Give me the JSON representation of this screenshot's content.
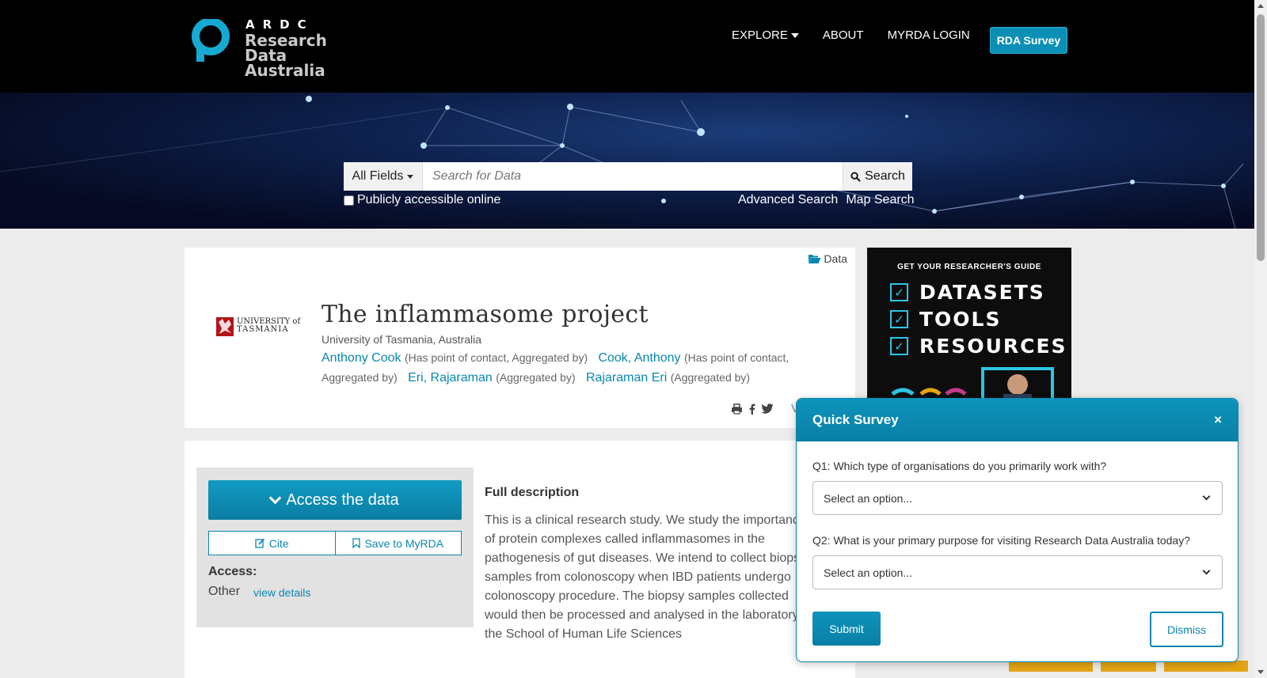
{
  "header": {
    "logo_ardc": "ARDC",
    "logo_line1": "Research Data",
    "logo_line2": "Australia",
    "nav": [
      {
        "label": "EXPLORE"
      },
      {
        "label": "ABOUT"
      },
      {
        "label": "MYRDA LOGIN"
      }
    ],
    "survey_button": "RDA Survey"
  },
  "search": {
    "field_select": "All Fields",
    "placeholder": "Search for Data",
    "button": "Search",
    "public_checkbox_label": "Publicly accessible online",
    "public_checked": false,
    "advanced_link": "Advanced Search",
    "map_link": "Map Search"
  },
  "record": {
    "type_badge": "Data",
    "logo_text_line1": "UNIVERSITY of",
    "logo_text_line2": "TASMANIA",
    "title": "The inflammasome project",
    "organisation": "University of Tasmania, Australia",
    "contacts": [
      {
        "name": "Anthony Cook",
        "role": "(Has point of contact, Aggregated by)"
      },
      {
        "name": "Cook, Anthony",
        "role": "(Has point of contact, Aggregated by)"
      },
      {
        "name": "Eri, Rajaraman",
        "role": "(Aggregated by)"
      },
      {
        "name": "Rajaraman Eri",
        "role": "(Aggregated by)"
      }
    ],
    "share_text": "Vi"
  },
  "access": {
    "access_button": "Access the data",
    "cite_button": "Cite",
    "save_button": "Save to MyRDA",
    "access_label": "Access:",
    "access_value": "Other",
    "view_details": "view details"
  },
  "description": {
    "heading": "Full description",
    "text": "This is a clinical research study. We study the importance of protein complexes called inflammasomes in the pathogenesis of gut diseases. We intend to collect biopsy samples from colonoscopy when IBD patients undergo colonoscopy procedure. The biopsy samples collected would then be processed and analysed in the laboratory at the School of Human Life Sciences"
  },
  "ad": {
    "kicker": "GET YOUR RESEARCHER'S GUIDE",
    "items": [
      "DATASETS",
      "TOOLS",
      "RESOURCES"
    ],
    "accent": "#2ec4e6"
  },
  "survey": {
    "title": "Quick Survey",
    "close": "×",
    "q1": "Q1: Which type of organisations do you primarily work with?",
    "q1_value": "Select an option...",
    "q2": "Q2: What is your primary purpose for visiting Research Data Australia today?",
    "q2_value": "Select an option...",
    "submit": "Submit",
    "dismiss": "Dismiss"
  },
  "colors": {
    "brand": "#0a87b0",
    "header_bg": "#000000",
    "accent_yellow": "#e5a514"
  }
}
